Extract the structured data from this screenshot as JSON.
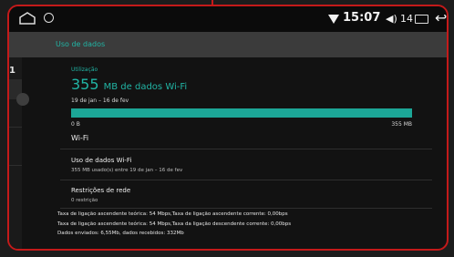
{
  "statusbar": {
    "time": "15:07",
    "volume_icon": "speaker-icon",
    "volume_level": "14"
  },
  "appbar": {
    "title": "Uso de dados"
  },
  "left_panel": {
    "digit": "1"
  },
  "usage": {
    "label": "Utilização",
    "amount": "355",
    "unit": "MB de dados Wi-Fi",
    "date_range": "19 de jan – 16 de fev",
    "fill_fraction": 1.0,
    "min_label": "0 B",
    "max_label": "355 MB"
  },
  "wifi_section": {
    "header": "Wi-Fi",
    "items": [
      {
        "title": "Uso de dados Wi-Fi",
        "subtitle": "355 MB usado(s) entre 19 de jan – 16 de fev"
      },
      {
        "title": "Restrições de rede",
        "subtitle": "0 restrição"
      }
    ]
  },
  "info_lines": [
    "Taxa de ligação ascendente teórica: 54 Mbps,Taxa de ligação ascendente corrente: 0,00bps",
    "Taxa de ligação ascendente teórica: 54 Mbps,Taxa da ligação descendente corrente: 0,00bps",
    "Dados enviados: 6,55Mb, dados recebidos: 332Mb"
  ],
  "colors": {
    "accent": "#21b5a5",
    "bar": "#1ca697",
    "bezel": "#c41a1a"
  }
}
